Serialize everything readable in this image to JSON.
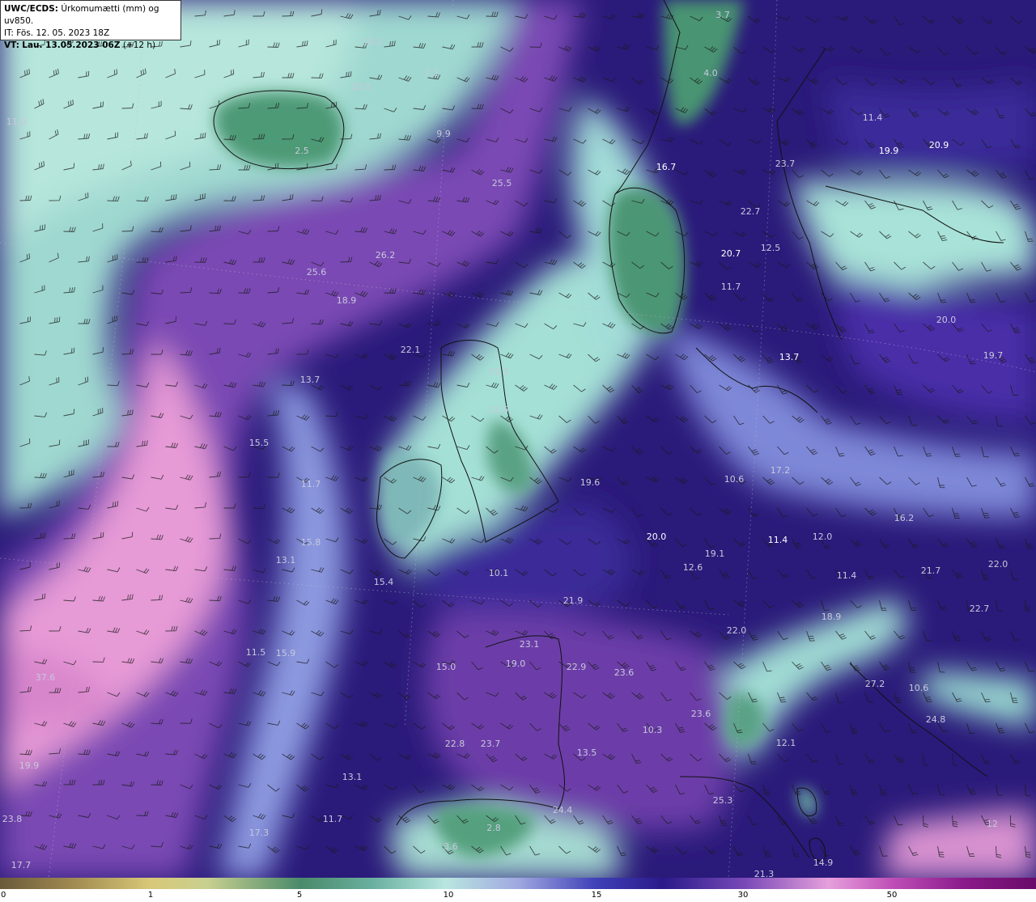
{
  "header": {
    "title_prefix": "UWC/ECDS:",
    "title_text": "Úrkomumætti (mm) og uv850.",
    "it_prefix": "IT:",
    "it_text": "Fös. 12. 05. 2023 18Z",
    "vt_prefix": "VT:",
    "vt_text": "Lau. 13.05.2023 06Z",
    "vt_offset": "(+12 h)"
  },
  "colors": {
    "bg_dark": "#23147a",
    "bg_purple": "#6a3a9a",
    "light_purple": "#b06ac0",
    "pink": "#e898d4",
    "pale_cyan": "#a8e0dc",
    "teal": "#7cc4b0",
    "land_green": "#4f9a78",
    "mid_blue": "#5a5ec8"
  },
  "colorbar": {
    "ticks": [
      "0",
      "1",
      "5",
      "10",
      "15",
      "30",
      "50"
    ]
  },
  "map_labels": [
    {
      "text": "3.7",
      "bright": false
    },
    {
      "text": "4.0",
      "bright": false
    },
    {
      "text": "10.5",
      "bright": false
    },
    {
      "text": "10.5",
      "bright": false
    },
    {
      "text": "7.2",
      "bright": false
    },
    {
      "text": "9.9",
      "bright": false
    },
    {
      "text": "11.0",
      "bright": false
    },
    {
      "text": "2.5",
      "bright": false
    },
    {
      "text": "11.4",
      "bright": false
    },
    {
      "text": "19.9",
      "bright": true
    },
    {
      "text": "20.9",
      "bright": true
    },
    {
      "text": "23.7",
      "bright": false
    },
    {
      "text": "16.7",
      "bright": true
    },
    {
      "text": "25.5",
      "bright": false
    },
    {
      "text": "22.7",
      "bright": false
    },
    {
      "text": "26.2",
      "bright": false
    },
    {
      "text": "12.5",
      "bright": false
    },
    {
      "text": "20.7",
      "bright": true
    },
    {
      "text": "25.6",
      "bright": false
    },
    {
      "text": "11.7",
      "bright": false
    },
    {
      "text": "18.9",
      "bright": false
    },
    {
      "text": "20.0",
      "bright": false
    },
    {
      "text": "19.7",
      "bright": false
    },
    {
      "text": "22.1",
      "bright": false
    },
    {
      "text": "13.7",
      "bright": false
    },
    {
      "text": "13.7",
      "bright": true
    },
    {
      "text": "15.3",
      "bright": false
    },
    {
      "text": "15.5",
      "bright": false
    },
    {
      "text": "15.5",
      "bright": false
    },
    {
      "text": "17.2",
      "bright": false
    },
    {
      "text": "19.6",
      "bright": false
    },
    {
      "text": "10.6",
      "bright": false
    },
    {
      "text": "11.7",
      "bright": false
    },
    {
      "text": "15.8",
      "bright": false
    },
    {
      "text": "20.0",
      "bright": true
    },
    {
      "text": "11.4",
      "bright": true
    },
    {
      "text": "12.0",
      "bright": false
    },
    {
      "text": "19.1",
      "bright": false
    },
    {
      "text": "12.6",
      "bright": false
    },
    {
      "text": "16.2",
      "bright": false
    },
    {
      "text": "22.0",
      "bright": false
    },
    {
      "text": "21.7",
      "bright": false
    },
    {
      "text": "13.1",
      "bright": false
    },
    {
      "text": "15.4",
      "bright": false
    },
    {
      "text": "10.1",
      "bright": false
    },
    {
      "text": "11.4",
      "bright": false
    },
    {
      "text": "21.9",
      "bright": false
    },
    {
      "text": "22.7",
      "bright": false
    },
    {
      "text": "22.0",
      "bright": false
    },
    {
      "text": "18.9",
      "bright": false
    },
    {
      "text": "11.5",
      "bright": false
    },
    {
      "text": "15.9",
      "bright": false
    },
    {
      "text": "23.1",
      "bright": false
    },
    {
      "text": "19.0",
      "bright": false
    },
    {
      "text": "15.0",
      "bright": false
    },
    {
      "text": "22.9",
      "bright": false
    },
    {
      "text": "23.6",
      "bright": false
    },
    {
      "text": "27.2",
      "bright": false
    },
    {
      "text": "10.6",
      "bright": false
    },
    {
      "text": "37.6",
      "bright": false
    },
    {
      "text": "23.6",
      "bright": false
    },
    {
      "text": "10.3",
      "bright": false
    },
    {
      "text": "24.8",
      "bright": false
    },
    {
      "text": "22.8",
      "bright": false
    },
    {
      "text": "23.7",
      "bright": false
    },
    {
      "text": "13.5",
      "bright": false
    },
    {
      "text": "12.1",
      "bright": false
    },
    {
      "text": "19.9",
      "bright": false
    },
    {
      "text": "13.1",
      "bright": false
    },
    {
      "text": "25.3",
      "bright": false
    },
    {
      "text": "23.8",
      "bright": false
    },
    {
      "text": "24.4",
      "bright": false
    },
    {
      "text": "2.8",
      "bright": false
    },
    {
      "text": "11.7",
      "bright": false
    },
    {
      "text": "17.3",
      "bright": false
    },
    {
      "text": "3.6",
      "bright": false
    },
    {
      "text": "12",
      "bright": false
    },
    {
      "text": "17.7",
      "bright": false
    },
    {
      "text": "14.9",
      "bright": false
    },
    {
      "text": "21.3",
      "bright": false
    }
  ]
}
